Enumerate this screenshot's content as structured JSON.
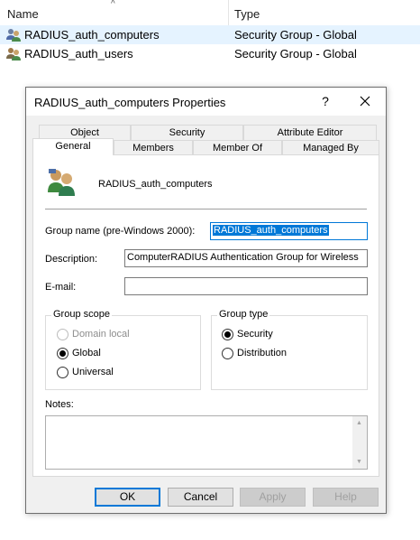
{
  "explorer": {
    "columns": {
      "name": "Name",
      "type": "Type"
    },
    "sort_indicator": "^",
    "rows": [
      {
        "name": "RADIUS_auth_computers",
        "type": "Security Group - Global",
        "icon": "group-icon"
      },
      {
        "name": "RADIUS_auth_users",
        "type": "Security Group - Global",
        "icon": "group-icon"
      }
    ]
  },
  "dialog": {
    "title": "RADIUS_auth_computers Properties",
    "help_glyph": "?",
    "tabs_back": [
      "Object",
      "Security",
      "Attribute Editor"
    ],
    "tabs_front": [
      "General",
      "Members",
      "Member Of",
      "Managed By"
    ],
    "active_tab": "General",
    "group_display_name": "RADIUS_auth_computers",
    "fields": {
      "pre_win2000_label": "Group name (pre-Windows 2000):",
      "pre_win2000_value": "RADIUS_auth_computers",
      "description_label": "Description:",
      "description_value": "ComputerRADIUS Authentication Group for Wireless",
      "email_label": "E-mail:",
      "email_value": ""
    },
    "group_scope": {
      "title": "Group scope",
      "options": [
        {
          "label": "Domain local",
          "checked": false,
          "disabled": true
        },
        {
          "label": "Global",
          "checked": true,
          "disabled": false
        },
        {
          "label": "Universal",
          "checked": false,
          "disabled": false
        }
      ]
    },
    "group_type": {
      "title": "Group type",
      "options": [
        {
          "label": "Security",
          "checked": true
        },
        {
          "label": "Distribution",
          "checked": false
        }
      ]
    },
    "notes_label": "Notes:",
    "notes_value": "",
    "buttons": {
      "ok": "OK",
      "cancel": "Cancel",
      "apply": "Apply",
      "help": "Help"
    }
  },
  "colors": {
    "selection_row": "#e5f3ff",
    "accent": "#0078d7",
    "dialog_bg": "#f0f0f0"
  }
}
